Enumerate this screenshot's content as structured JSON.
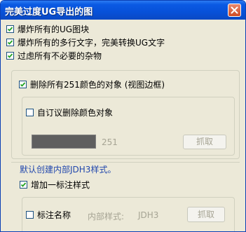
{
  "window": {
    "title": "完美过度UG导出的图"
  },
  "options": [
    {
      "label": "爆炸所有的UG图块",
      "checked": true
    },
    {
      "label": "爆炸所有的多行文字，完美转换UG文字",
      "checked": true
    },
    {
      "label": "过虑所有不必要的杂物",
      "checked": true
    }
  ],
  "color_panel": {
    "remove_label": "删除所有251颜色的对象 (视图边框)",
    "remove_checked": true,
    "custom_label": "自订议删除颜色对象",
    "custom_checked": false,
    "color_value": "251",
    "pick_button": "抓取",
    "swatch_color": "#5f5f5f"
  },
  "style_section": {
    "heading": "默认创建内部JDH3样式。",
    "add_label": "增加一标注样式",
    "add_checked": true,
    "name_label": "标注名称",
    "name_checked": false,
    "inner_style_label": "内部样式:",
    "inner_style_value": "JDH3",
    "pick_button": "抓取"
  }
}
